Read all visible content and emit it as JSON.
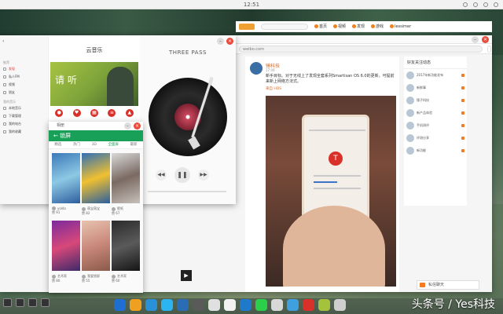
{
  "status_bar": {
    "time": "12:51"
  },
  "browser": {
    "tab_label": "微博",
    "url": "weibo.com",
    "search_placeholder": "",
    "nav": {
      "links": [
        "首页",
        "视频",
        "发现",
        "游戏",
        "lessimer"
      ]
    },
    "feed": {
      "author": "锤科技",
      "time": "17:09",
      "text": "新手目标。对于无线上了发现全套系列Smartisan OS 6.0的更新，可提前来新上网络方法式。",
      "tag": "来自 HDS"
    },
    "side_panel": {
      "title": "好友关注动态",
      "items": [
        "2017年新功能发布",
        "新鲜事",
        "锤子科技",
        "新产品体验",
        "手机测评",
        "评测分享",
        "新功能"
      ]
    },
    "chat_label": "私信聊天"
  },
  "music_app": {
    "title": "云音乐",
    "song_title": "THREE PASS",
    "song_subtitle": "",
    "banner_text": "请 听",
    "left_sections": [
      "推荐",
      "我的音乐"
    ],
    "left_items": [
      "发现",
      "私人FM",
      "视频",
      "朋友",
      "本地音乐",
      "下载管理",
      "我的电台",
      "我的收藏"
    ]
  },
  "gallery_app": {
    "window_title": "相册",
    "header": "锁屏",
    "tabs": [
      "精选",
      "热门",
      "3D",
      "全面屏",
      "最新"
    ],
    "active_tab": "全面屏",
    "users": [
      {
        "name": "yoldo",
        "likes": "赞 91"
      },
      {
        "name": "萌宝萌宝",
        "likes": "赞 82"
      },
      {
        "name": "壁纸",
        "likes": "赞 67"
      },
      {
        "name": "艺术家",
        "likes": "赞 80"
      },
      {
        "name": "我爱锁屏",
        "likes": "赞 55"
      },
      {
        "name": "艺术家",
        "likes": "赞 60"
      }
    ]
  },
  "watermark": "头条号 / Yes科技"
}
